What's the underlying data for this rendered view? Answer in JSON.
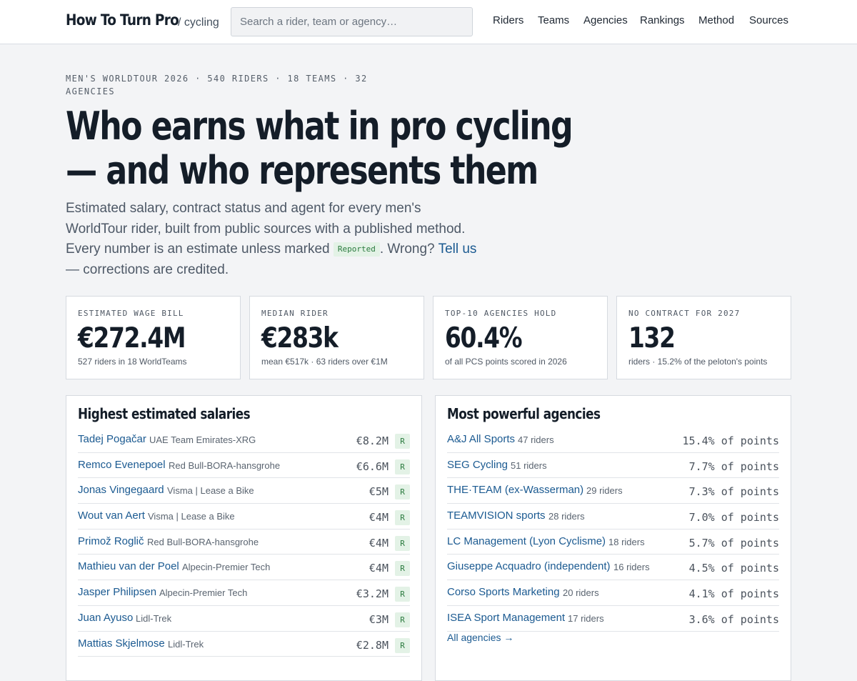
{
  "header": {
    "brand": "How To Turn Pro",
    "brand_sub": "/ cycling",
    "search_placeholder": "Search a rider, team or agency…",
    "nav": [
      "Riders",
      "Teams",
      "Agencies",
      "Rankings",
      "Method",
      "Sources"
    ]
  },
  "hero": {
    "eyebrow": "Men's WorldTour 2026 · 540 riders · 18 teams · 32 agencies",
    "headline": "Who earns what in pro cycling — and who represents them",
    "intro_before": "Estimated salary, contract status and agent for every men's WorldTour rider, built from public sources with a published method. Every number is an estimate unless marked ",
    "intro_tag": "Reported",
    "intro_middle": ". Wrong? ",
    "intro_link": "Tell us",
    "intro_after": " — corrections are credited."
  },
  "stats": [
    {
      "label": "Estimated wage bill",
      "value": "€272.4M",
      "note": "527 riders in 18 WorldTeams"
    },
    {
      "label": "Median rider",
      "value": "€283k",
      "note": "mean €517k · 63 riders over €1M"
    },
    {
      "label": "Top-10 agencies hold",
      "value": "60.4%",
      "note": "of all PCS points scored in 2026"
    },
    {
      "label": "No contract for 2027",
      "value": "132",
      "note": "riders · 15.2% of the peloton's points"
    }
  ],
  "salaries": {
    "title": "Highest estimated salaries",
    "rows": [
      {
        "name": "Tadej Pogačar",
        "team": "UAE Team Emirates-XRG",
        "amount": "€8.2M",
        "tag": "R"
      },
      {
        "name": "Remco Evenepoel",
        "team": "Red Bull-BORA-hansgrohe",
        "amount": "€6.6M",
        "tag": "R"
      },
      {
        "name": "Jonas Vingegaard",
        "team": "Visma | Lease a Bike",
        "amount": "€5M",
        "tag": "R"
      },
      {
        "name": "Wout van Aert",
        "team": "Visma | Lease a Bike",
        "amount": "€4M",
        "tag": "R"
      },
      {
        "name": "Primož Roglič",
        "team": "Red Bull-BORA-hansgrohe",
        "amount": "€4M",
        "tag": "R"
      },
      {
        "name": "Mathieu van der Poel",
        "team": "Alpecin-Premier Tech",
        "amount": "€4M",
        "tag": "R"
      },
      {
        "name": "Jasper Philipsen",
        "team": "Alpecin-Premier Tech",
        "amount": "€3.2M",
        "tag": "R"
      },
      {
        "name": "Juan Ayuso",
        "team": "Lidl-Trek",
        "amount": "€3M",
        "tag": "R"
      },
      {
        "name": "Mattias Skjelmose",
        "team": "Lidl-Trek",
        "amount": "€2.8M",
        "tag": "R"
      }
    ]
  },
  "agencies": {
    "title": "Most powerful agencies",
    "rows": [
      {
        "name": "A&J All Sports",
        "riders": "47 riders",
        "share": "15.4% of points"
      },
      {
        "name": "SEG Cycling",
        "riders": "51 riders",
        "share": "7.7% of points"
      },
      {
        "name": "THE·TEAM (ex-Wasserman)",
        "riders": "29 riders",
        "share": "7.3% of points"
      },
      {
        "name": "TEAMVISION sports",
        "riders": "28 riders",
        "share": "7.0% of points"
      },
      {
        "name": "LC Management (Lyon Cyclisme)",
        "riders": "18 riders",
        "share": "5.7% of points"
      },
      {
        "name": "Giuseppe Acquadro (independent)",
        "riders": "16 riders",
        "share": "4.5% of points"
      },
      {
        "name": "Corso Sports Marketing",
        "riders": "20 riders",
        "share": "4.1% of points"
      },
      {
        "name": "ISEA Sport Management",
        "riders": "17 riders",
        "share": "3.6% of points"
      }
    ],
    "more": "All agencies →"
  }
}
